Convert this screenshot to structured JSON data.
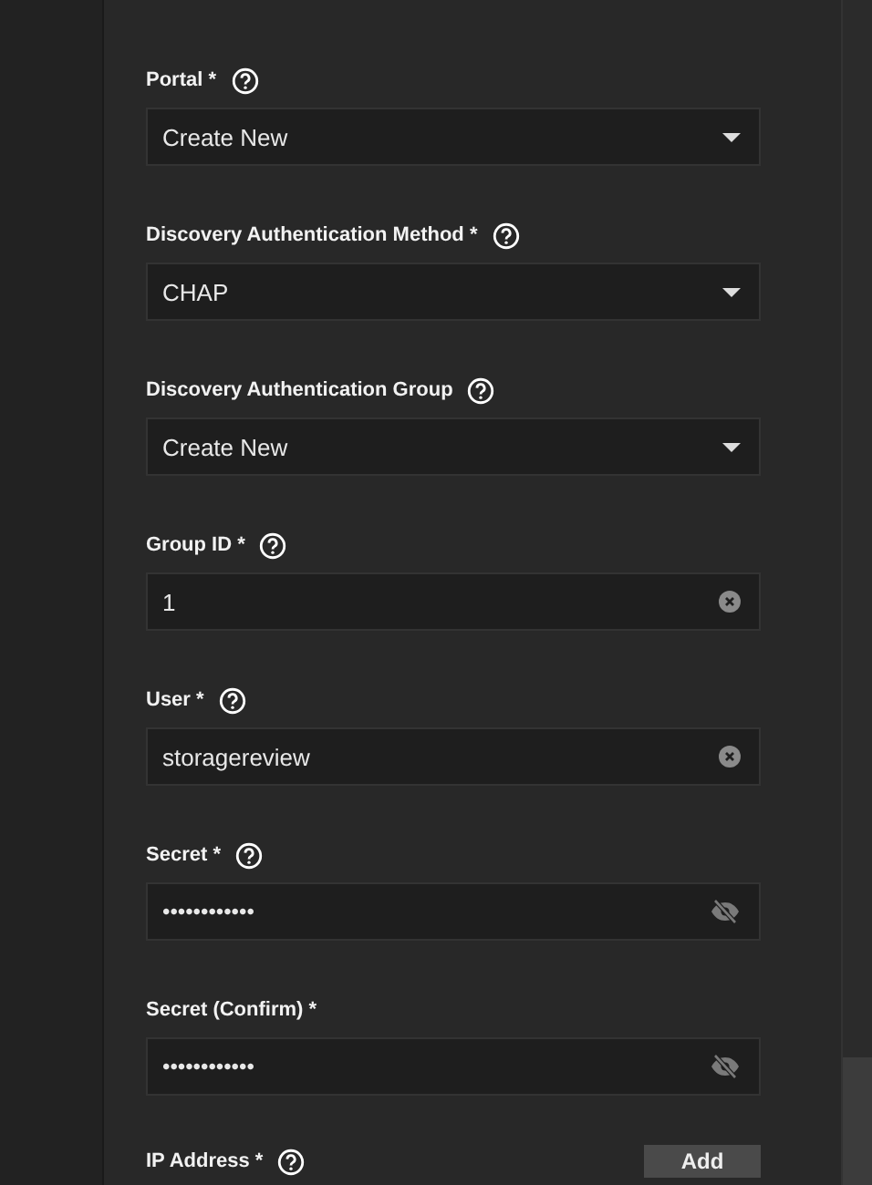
{
  "fields": [
    {
      "kind": "select",
      "label": "Portal *",
      "help": true,
      "value": "Create New"
    },
    {
      "kind": "select",
      "label": "Discovery Authentication Method *",
      "help": true,
      "value": "CHAP"
    },
    {
      "kind": "select",
      "label": "Discovery Authentication Group",
      "help": true,
      "value": "Create New"
    },
    {
      "kind": "text",
      "label": "Group ID *",
      "help": true,
      "value": "1"
    },
    {
      "kind": "text",
      "label": "User *",
      "help": true,
      "value": "storagereview"
    },
    {
      "kind": "password",
      "label": "Secret *",
      "help": true,
      "value": "••••••••••••"
    },
    {
      "kind": "password",
      "label": "Secret (Confirm) *",
      "help": false,
      "value": "••••••••••••"
    }
  ],
  "ip_addresses": {
    "label": "IP Address *",
    "help": true,
    "button": "Add"
  }
}
